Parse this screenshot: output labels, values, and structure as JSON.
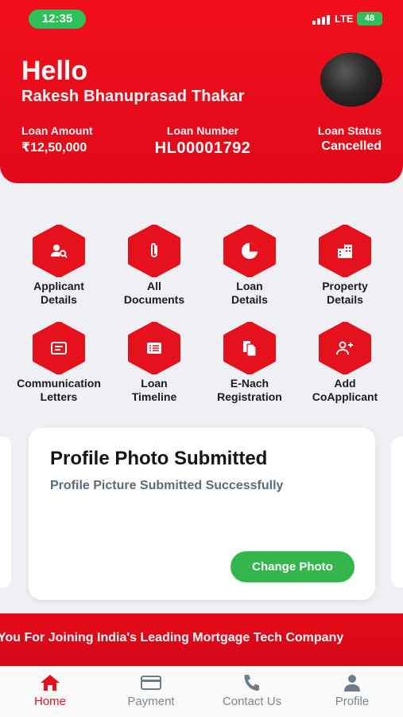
{
  "status_bar": {
    "time": "12:35",
    "network": "LTE",
    "battery": "48"
  },
  "header": {
    "greeting": "Hello",
    "user_name": "Rakesh Bhanuprasad Thakar",
    "loan_amount_label": "Loan Amount",
    "loan_amount_value": "₹12,50,000",
    "loan_number_label": "Loan Number",
    "loan_number_value": "HL00001792",
    "loan_status_label": "Loan Status",
    "loan_status_value": "Cancelled"
  },
  "colors": {
    "brand_red": "#e5111d",
    "success_green": "#35b64c",
    "time_green": "#2ec05a"
  },
  "grid": [
    {
      "line1": "Applicant",
      "line2": "Details",
      "icon": "user-search-icon"
    },
    {
      "line1": "All",
      "line2": "Documents",
      "icon": "paperclip-icon"
    },
    {
      "line1": "Loan",
      "line2": "Details",
      "icon": "pie-chart-icon"
    },
    {
      "line1": "Property",
      "line2": "Details",
      "icon": "building-icon"
    },
    {
      "line1": "Communication",
      "line2": "Letters",
      "icon": "letter-icon"
    },
    {
      "line1": "Loan",
      "line2": "Timeline",
      "icon": "list-icon"
    },
    {
      "line1": "E-Nach",
      "line2": "Registration",
      "icon": "documents-icon"
    },
    {
      "line1": "Add",
      "line2": "CoApplicant",
      "icon": "add-user-icon"
    }
  ],
  "card": {
    "title": "Profile Photo Submitted",
    "subtitle": "Profile Picture Submitted Successfully",
    "button": "Change Photo"
  },
  "banner": {
    "text": "You For Joining India's Leading Mortgage Tech Company"
  },
  "nav": {
    "home": "Home",
    "payment": "Payment",
    "contact": "Contact Us",
    "profile": "Profile"
  }
}
